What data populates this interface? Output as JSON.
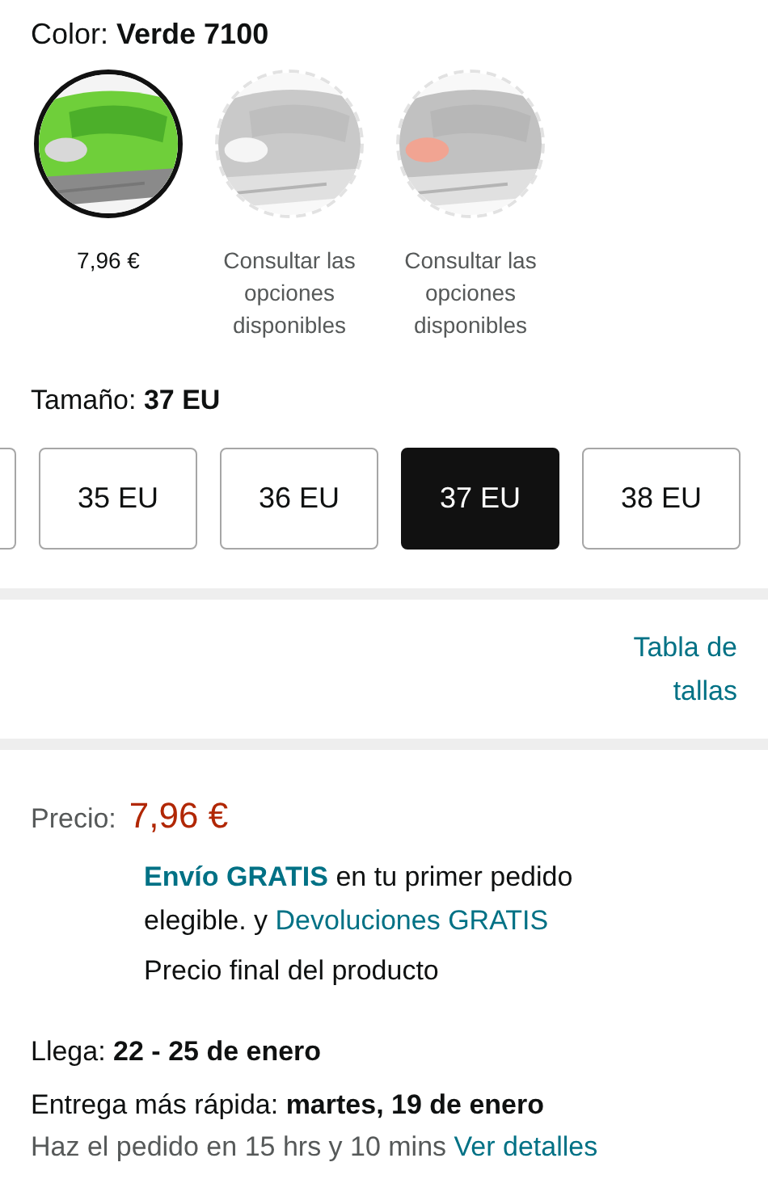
{
  "color": {
    "label": "Color: **Verde 7100**"
  },
  "swatches": [
    {
      "kind": "picture",
      "caption": "7,96 €",
      "selected": true,
      "available": true
    },
    {
      "kind": "picture",
      "caption": "Consultar las opciones disponibles",
      "selected": false,
      "available": false
    },
    {
      "kind": "picture",
      "caption": "Consultar las opciones disponibles",
      "selected": false,
      "available": false
    }
  ],
  "size": {
    "label": "Tamaño: **37 EU**"
  },
  "sizes": [
    {
      "label": "35 EU",
      "selected": false
    },
    {
      "label": "36 EU",
      "selected": false
    },
    {
      "label": "37 EU",
      "selected": true
    },
    {
      "label": "38 EU",
      "selected": false
    }
  ],
  "size_chart_link": "Tabla de tallas",
  "price": {
    "label": "Precio:",
    "value": "7,96 €"
  },
  "shipping": {
    "free_shipping_link": "Envío GRATIS",
    "text": "en tu primer pedido elegible. y",
    "returns_link": "Devoluciones GRATIS"
  },
  "final_price_note": "Precio final del producto",
  "arrival": "Llega: **22 - 25 de enero**",
  "fastest": "Entrega más rápida: **martes, 19 de enero**",
  "order_within": {
    "text": "Haz el pedido en 15 hrs y 10 mins",
    "details_link": "Ver detalles"
  }
}
